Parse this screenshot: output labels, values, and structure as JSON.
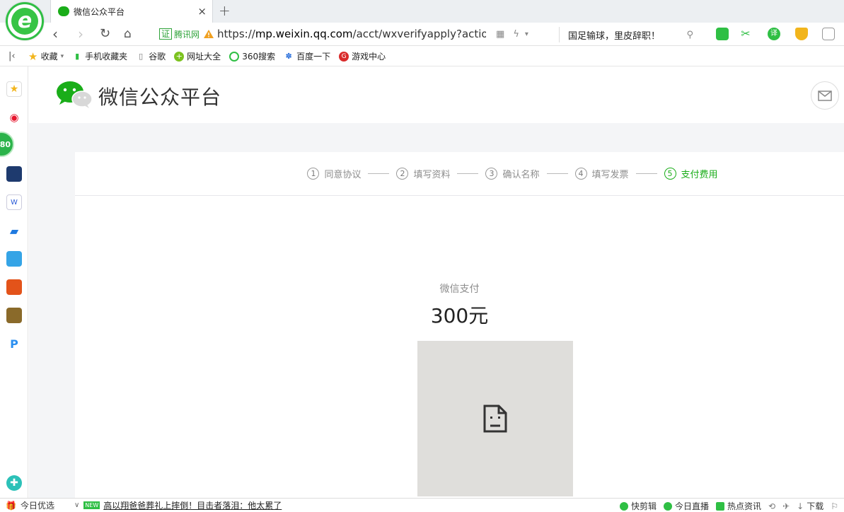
{
  "tab": {
    "title": "微信公众平台",
    "close": "×",
    "new_tab": "+"
  },
  "address": {
    "cert_icon": "证",
    "cert_label": "腾讯网",
    "url_prefix": "https://",
    "url_domain": "mp.weixin.qq.com",
    "url_path": "/acct/wxverifyapply?action=inc",
    "search_text": "国足输球，里皮辞职！"
  },
  "bookmarks": [
    {
      "label": "收藏",
      "icon": "star-icon"
    },
    {
      "label": "手机收藏夹",
      "icon": "phone-icon"
    },
    {
      "label": "谷歌",
      "icon": "page-icon"
    },
    {
      "label": "网址大全",
      "icon": "plus-icon"
    },
    {
      "label": "360搜索",
      "icon": "search-360-icon"
    },
    {
      "label": "百度一下",
      "icon": "baidu-paw-icon"
    },
    {
      "label": "游戏中心",
      "icon": "game-icon"
    }
  ],
  "sidebar": {
    "ball_label": "80"
  },
  "page": {
    "brand_title": "微信公众平台",
    "steps": [
      {
        "num": "1",
        "label": "同意协议",
        "active": false
      },
      {
        "num": "2",
        "label": "填写资料",
        "active": false
      },
      {
        "num": "3",
        "label": "确认名称",
        "active": false
      },
      {
        "num": "4",
        "label": "填写发票",
        "active": false
      },
      {
        "num": "5",
        "label": "支付费用",
        "active": true
      }
    ],
    "pay_label": "微信支付",
    "pay_amount": "300元"
  },
  "status": {
    "today": "今日优选",
    "news_badge": "NEW",
    "news": "高以翔爸爸葬礼上摔倒！目击者落泪：他太累了",
    "quick_cut": "快剪辑",
    "live": "今日直播",
    "hot": "热点资讯",
    "download": "下载"
  },
  "colors": {
    "wechat_green": "#1aad19",
    "browser_green": "#2fbf44"
  }
}
